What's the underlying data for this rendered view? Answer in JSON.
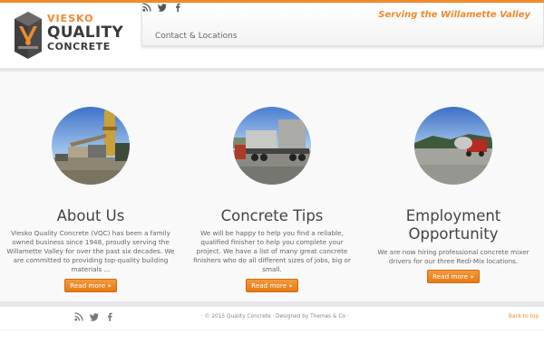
{
  "brand": {
    "logo_top": "VIESKO",
    "logo_middle": "QUALITY",
    "logo_bottom": "CONCRETE",
    "accent_color": "#f08a2c",
    "dark_color": "#3a3a3a"
  },
  "header": {
    "tagline": "Serving the Willamette Valley",
    "nav_items": [
      {
        "label": "Contact & Locations"
      }
    ],
    "social_icons": [
      "rss-icon",
      "twitter-icon",
      "facebook-icon"
    ]
  },
  "features": [
    {
      "image": "concrete-plant-photo",
      "title": "About Us",
      "text": "Viesko Quality Concrete (VQC) has been a family owned business since 1948, proudly serving the Willamette Valley for over the past six decades. We are committed to providing top-quality building materials ...",
      "button": "Read more »"
    },
    {
      "image": "flatbed-truck-photo",
      "title": "Concrete Tips",
      "text": "We will be happy to help you find a reliable, qualified finisher to help you complete your project. We have a list of many great concrete finishers who do all different sizes of jobs, big or small.",
      "button": "Read more »"
    },
    {
      "image": "mixer-truck-lot-photo",
      "title": "Employment Opportunity",
      "text": "We are now hiring professional concrete mixer drivers for our three Redi-Mix locations.",
      "button": "Read more »"
    }
  ],
  "footer": {
    "copyright": "· © 2015 Quality Concrete · Designed by Themes & Co ·",
    "back_to_top": "Back to top",
    "social_icons": [
      "rss-icon",
      "twitter-icon",
      "facebook-icon"
    ]
  }
}
